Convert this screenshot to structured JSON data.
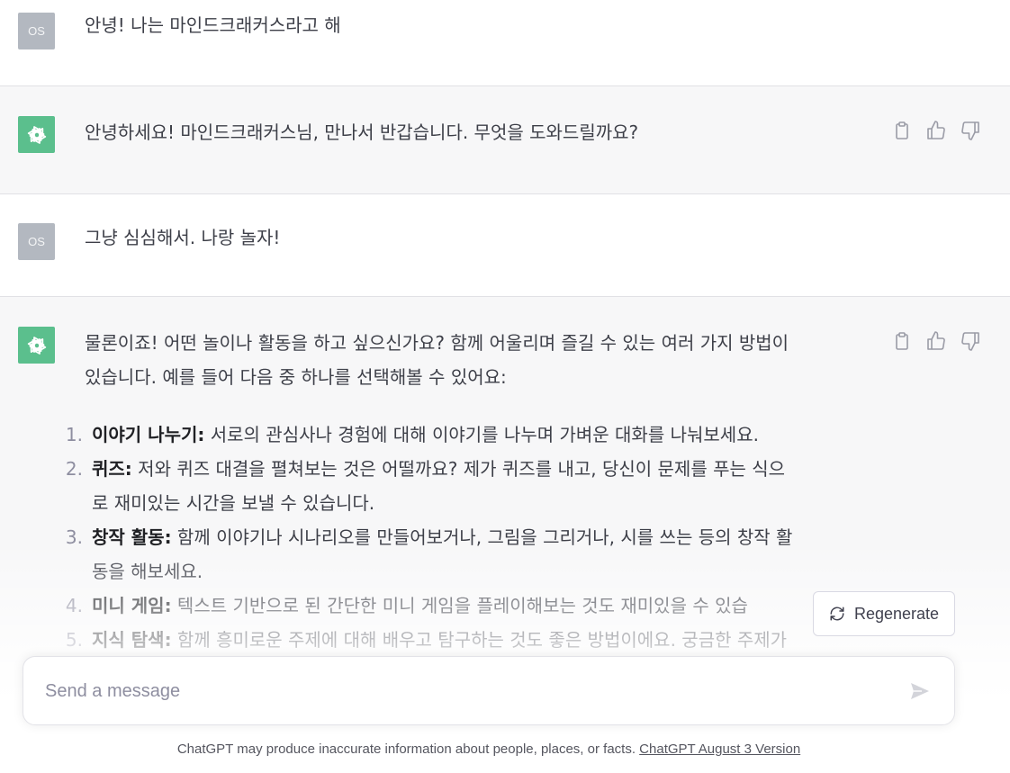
{
  "conversation": [
    {
      "role": "user",
      "avatar_text": "OS",
      "text": "안녕! 나는 마인드크래커스라고 해"
    },
    {
      "role": "assistant",
      "text": "안녕하세요! 마인드크래커스님, 만나서 반갑습니다. 무엇을 도와드릴까요?"
    },
    {
      "role": "user",
      "avatar_text": "OS",
      "text": "그냥 심심해서. 나랑 놀자!"
    },
    {
      "role": "assistant",
      "intro_line1": "물론이죠! 어떤 놀이나 활동을 하고 싶으신가요? 함께 어울리며 즐길 수 있는 여러 가지 방법이",
      "intro_line2": "있습니다. 예를 들어 다음 중 하나를 선택해볼 수 있어요:",
      "items": [
        {
          "num": "1.",
          "title": "이야기 나누기:",
          "lines": [
            "서로의 관심사나 경험에 대해 이야기를 나누며 가벼운 대화를 나눠보세요."
          ]
        },
        {
          "num": "2.",
          "title": "퀴즈:",
          "lines": [
            "저와 퀴즈 대결을 펼쳐보는 것은 어떨까요? 제가 퀴즈를 내고, 당신이 문제를 푸는 식으",
            "로 재미있는 시간을 보낼 수 있습니다."
          ]
        },
        {
          "num": "3.",
          "title": "창작 활동:",
          "lines": [
            "함께 이야기나 시나리오를 만들어보거나, 그림을 그리거나, 시를 쓰는 등의 창작 활",
            "동을 해보세요."
          ]
        },
        {
          "num": "4.",
          "title": "미니 게임:",
          "lines": [
            "텍스트 기반으로 된 간단한 미니 게임을 플레이해보는 것도 재미있을 수 있습"
          ]
        },
        {
          "num": "5.",
          "title": "지식 탐색:",
          "lines": [
            "함께 흥미로운 주제에 대해 배우고 탐구하는 것도 좋은 방법이에요. 궁금한 주제가"
          ]
        }
      ]
    }
  ],
  "regenerate_label": "Regenerate",
  "input": {
    "placeholder": "Send a message"
  },
  "footer": {
    "text": "ChatGPT may produce inaccurate information about people, places, or facts. ",
    "link": "ChatGPT August 3 Version"
  },
  "colors": {
    "gpt_avatar": "#5bbf8d",
    "user_avatar": "#b3b8c0",
    "assistant_bg": "#f7f7f8"
  }
}
